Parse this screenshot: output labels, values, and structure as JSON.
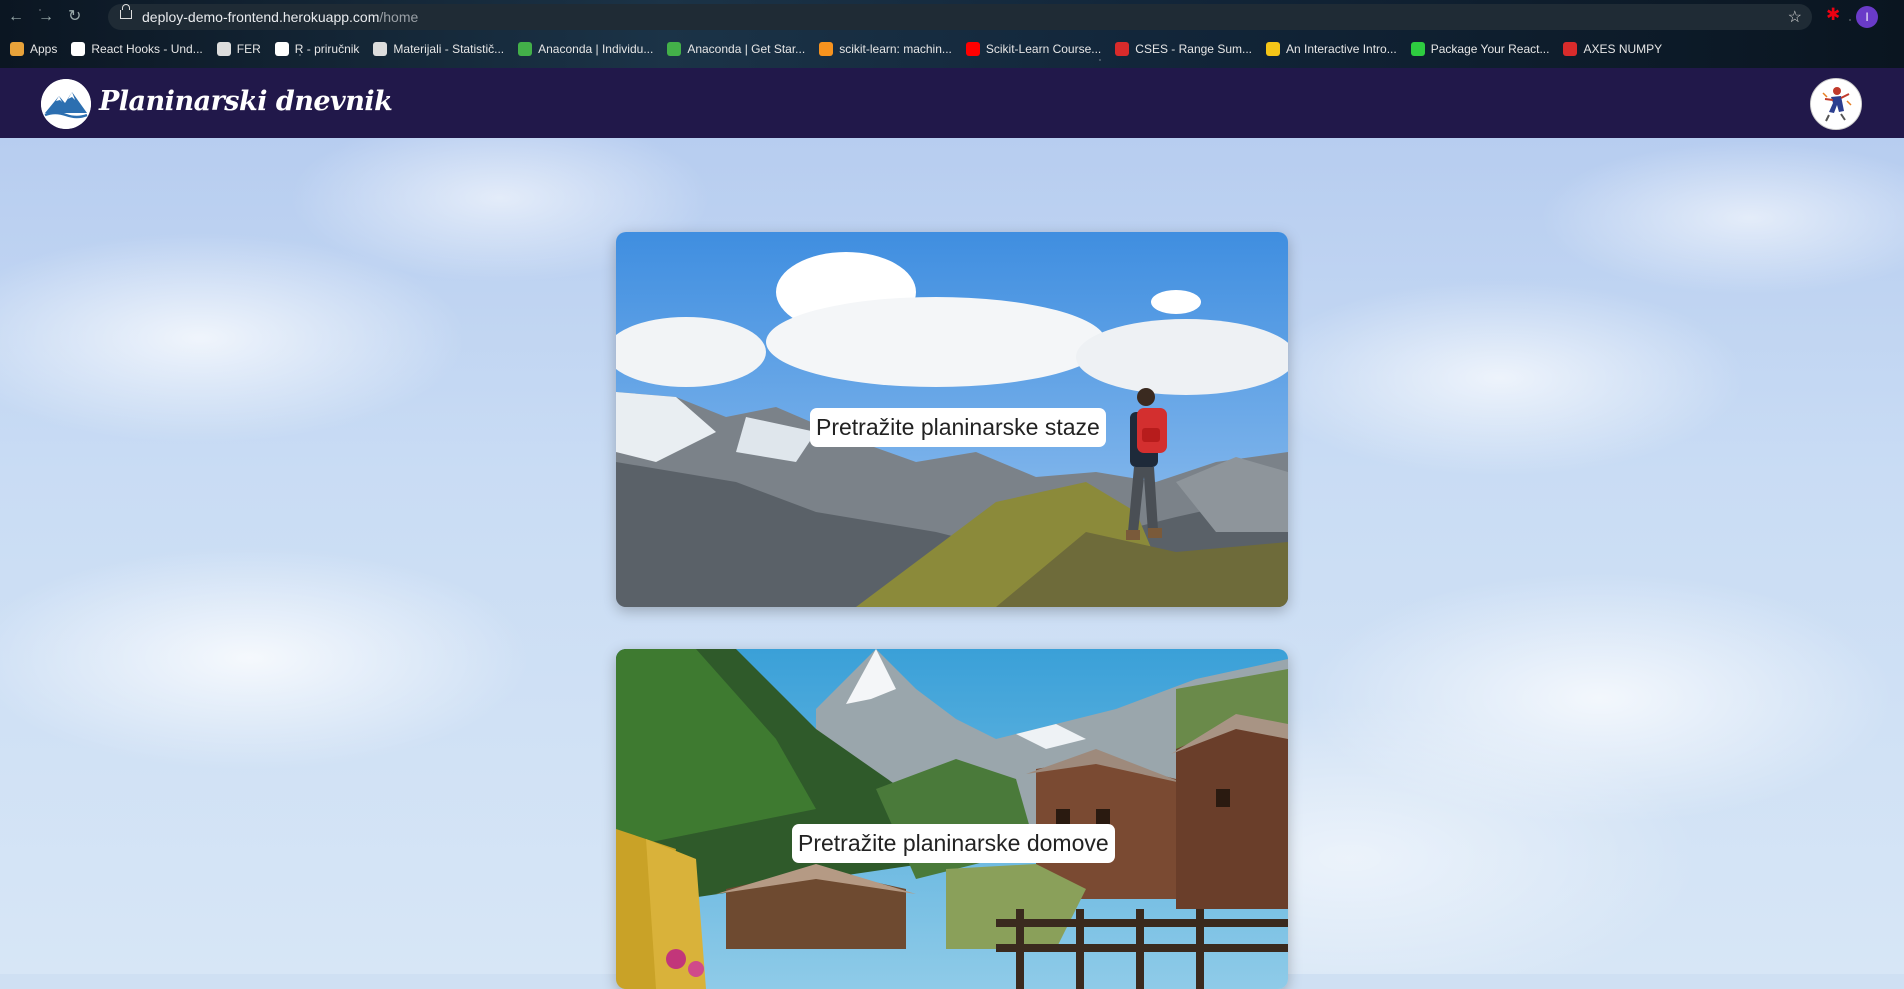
{
  "browser": {
    "url_host": "deploy-demo-frontend.herokuapp.com",
    "url_path": "/home",
    "profile_initial": "I",
    "bookmarks": [
      {
        "label": "Apps",
        "icon": "apps-grid-icon",
        "color": "#e8a23a"
      },
      {
        "label": "React Hooks - Und...",
        "icon": "medium-icon",
        "color": "#ffffff"
      },
      {
        "label": "FER",
        "icon": "fer-icon",
        "color": "#dddddd"
      },
      {
        "label": "R - priručnik",
        "icon": "github-icon",
        "color": "#ffffff"
      },
      {
        "label": "Materijali - Statistič...",
        "icon": "fer-icon",
        "color": "#dddddd"
      },
      {
        "label": "Anaconda | Individu...",
        "icon": "anaconda-icon",
        "color": "#43b049"
      },
      {
        "label": "Anaconda | Get Star...",
        "icon": "anaconda-icon",
        "color": "#43b049"
      },
      {
        "label": "scikit-learn: machin...",
        "icon": "scikit-icon",
        "color": "#f7931e"
      },
      {
        "label": "Scikit-Learn Course...",
        "icon": "youtube-icon",
        "color": "#ff0000"
      },
      {
        "label": "CSES - Range Sum...",
        "icon": "cses-icon",
        "color": "#d92b2b"
      },
      {
        "label": "An Interactive Intro...",
        "icon": "smiley-icon",
        "color": "#f5c518"
      },
      {
        "label": "Package Your React...",
        "icon": "package-icon",
        "color": "#2ecc40"
      },
      {
        "label": "AXES NUMPY",
        "icon": "cses-icon",
        "color": "#d92b2b"
      }
    ]
  },
  "navbar": {
    "brand": "Planinarski dnevnik"
  },
  "cards": [
    {
      "label": "Pretražite planinarske staze"
    },
    {
      "label": "Pretražite planinarske domove"
    }
  ]
}
